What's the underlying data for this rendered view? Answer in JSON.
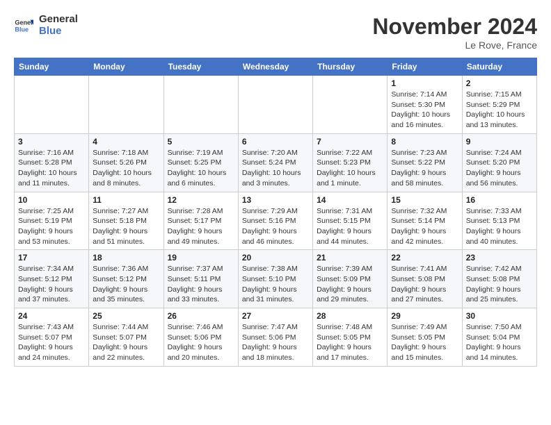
{
  "header": {
    "logo_general": "General",
    "logo_blue": "Blue",
    "month_title": "November 2024",
    "location": "Le Rove, France"
  },
  "weekdays": [
    "Sunday",
    "Monday",
    "Tuesday",
    "Wednesday",
    "Thursday",
    "Friday",
    "Saturday"
  ],
  "weeks": [
    [
      {
        "day": "",
        "info": ""
      },
      {
        "day": "",
        "info": ""
      },
      {
        "day": "",
        "info": ""
      },
      {
        "day": "",
        "info": ""
      },
      {
        "day": "",
        "info": ""
      },
      {
        "day": "1",
        "info": "Sunrise: 7:14 AM\nSunset: 5:30 PM\nDaylight: 10 hours and 16 minutes."
      },
      {
        "day": "2",
        "info": "Sunrise: 7:15 AM\nSunset: 5:29 PM\nDaylight: 10 hours and 13 minutes."
      }
    ],
    [
      {
        "day": "3",
        "info": "Sunrise: 7:16 AM\nSunset: 5:28 PM\nDaylight: 10 hours and 11 minutes."
      },
      {
        "day": "4",
        "info": "Sunrise: 7:18 AM\nSunset: 5:26 PM\nDaylight: 10 hours and 8 minutes."
      },
      {
        "day": "5",
        "info": "Sunrise: 7:19 AM\nSunset: 5:25 PM\nDaylight: 10 hours and 6 minutes."
      },
      {
        "day": "6",
        "info": "Sunrise: 7:20 AM\nSunset: 5:24 PM\nDaylight: 10 hours and 3 minutes."
      },
      {
        "day": "7",
        "info": "Sunrise: 7:22 AM\nSunset: 5:23 PM\nDaylight: 10 hours and 1 minute."
      },
      {
        "day": "8",
        "info": "Sunrise: 7:23 AM\nSunset: 5:22 PM\nDaylight: 9 hours and 58 minutes."
      },
      {
        "day": "9",
        "info": "Sunrise: 7:24 AM\nSunset: 5:20 PM\nDaylight: 9 hours and 56 minutes."
      }
    ],
    [
      {
        "day": "10",
        "info": "Sunrise: 7:25 AM\nSunset: 5:19 PM\nDaylight: 9 hours and 53 minutes."
      },
      {
        "day": "11",
        "info": "Sunrise: 7:27 AM\nSunset: 5:18 PM\nDaylight: 9 hours and 51 minutes."
      },
      {
        "day": "12",
        "info": "Sunrise: 7:28 AM\nSunset: 5:17 PM\nDaylight: 9 hours and 49 minutes."
      },
      {
        "day": "13",
        "info": "Sunrise: 7:29 AM\nSunset: 5:16 PM\nDaylight: 9 hours and 46 minutes."
      },
      {
        "day": "14",
        "info": "Sunrise: 7:31 AM\nSunset: 5:15 PM\nDaylight: 9 hours and 44 minutes."
      },
      {
        "day": "15",
        "info": "Sunrise: 7:32 AM\nSunset: 5:14 PM\nDaylight: 9 hours and 42 minutes."
      },
      {
        "day": "16",
        "info": "Sunrise: 7:33 AM\nSunset: 5:13 PM\nDaylight: 9 hours and 40 minutes."
      }
    ],
    [
      {
        "day": "17",
        "info": "Sunrise: 7:34 AM\nSunset: 5:12 PM\nDaylight: 9 hours and 37 minutes."
      },
      {
        "day": "18",
        "info": "Sunrise: 7:36 AM\nSunset: 5:12 PM\nDaylight: 9 hours and 35 minutes."
      },
      {
        "day": "19",
        "info": "Sunrise: 7:37 AM\nSunset: 5:11 PM\nDaylight: 9 hours and 33 minutes."
      },
      {
        "day": "20",
        "info": "Sunrise: 7:38 AM\nSunset: 5:10 PM\nDaylight: 9 hours and 31 minutes."
      },
      {
        "day": "21",
        "info": "Sunrise: 7:39 AM\nSunset: 5:09 PM\nDaylight: 9 hours and 29 minutes."
      },
      {
        "day": "22",
        "info": "Sunrise: 7:41 AM\nSunset: 5:08 PM\nDaylight: 9 hours and 27 minutes."
      },
      {
        "day": "23",
        "info": "Sunrise: 7:42 AM\nSunset: 5:08 PM\nDaylight: 9 hours and 25 minutes."
      }
    ],
    [
      {
        "day": "24",
        "info": "Sunrise: 7:43 AM\nSunset: 5:07 PM\nDaylight: 9 hours and 24 minutes."
      },
      {
        "day": "25",
        "info": "Sunrise: 7:44 AM\nSunset: 5:07 PM\nDaylight: 9 hours and 22 minutes."
      },
      {
        "day": "26",
        "info": "Sunrise: 7:46 AM\nSunset: 5:06 PM\nDaylight: 9 hours and 20 minutes."
      },
      {
        "day": "27",
        "info": "Sunrise: 7:47 AM\nSunset: 5:06 PM\nDaylight: 9 hours and 18 minutes."
      },
      {
        "day": "28",
        "info": "Sunrise: 7:48 AM\nSunset: 5:05 PM\nDaylight: 9 hours and 17 minutes."
      },
      {
        "day": "29",
        "info": "Sunrise: 7:49 AM\nSunset: 5:05 PM\nDaylight: 9 hours and 15 minutes."
      },
      {
        "day": "30",
        "info": "Sunrise: 7:50 AM\nSunset: 5:04 PM\nDaylight: 9 hours and 14 minutes."
      }
    ]
  ]
}
